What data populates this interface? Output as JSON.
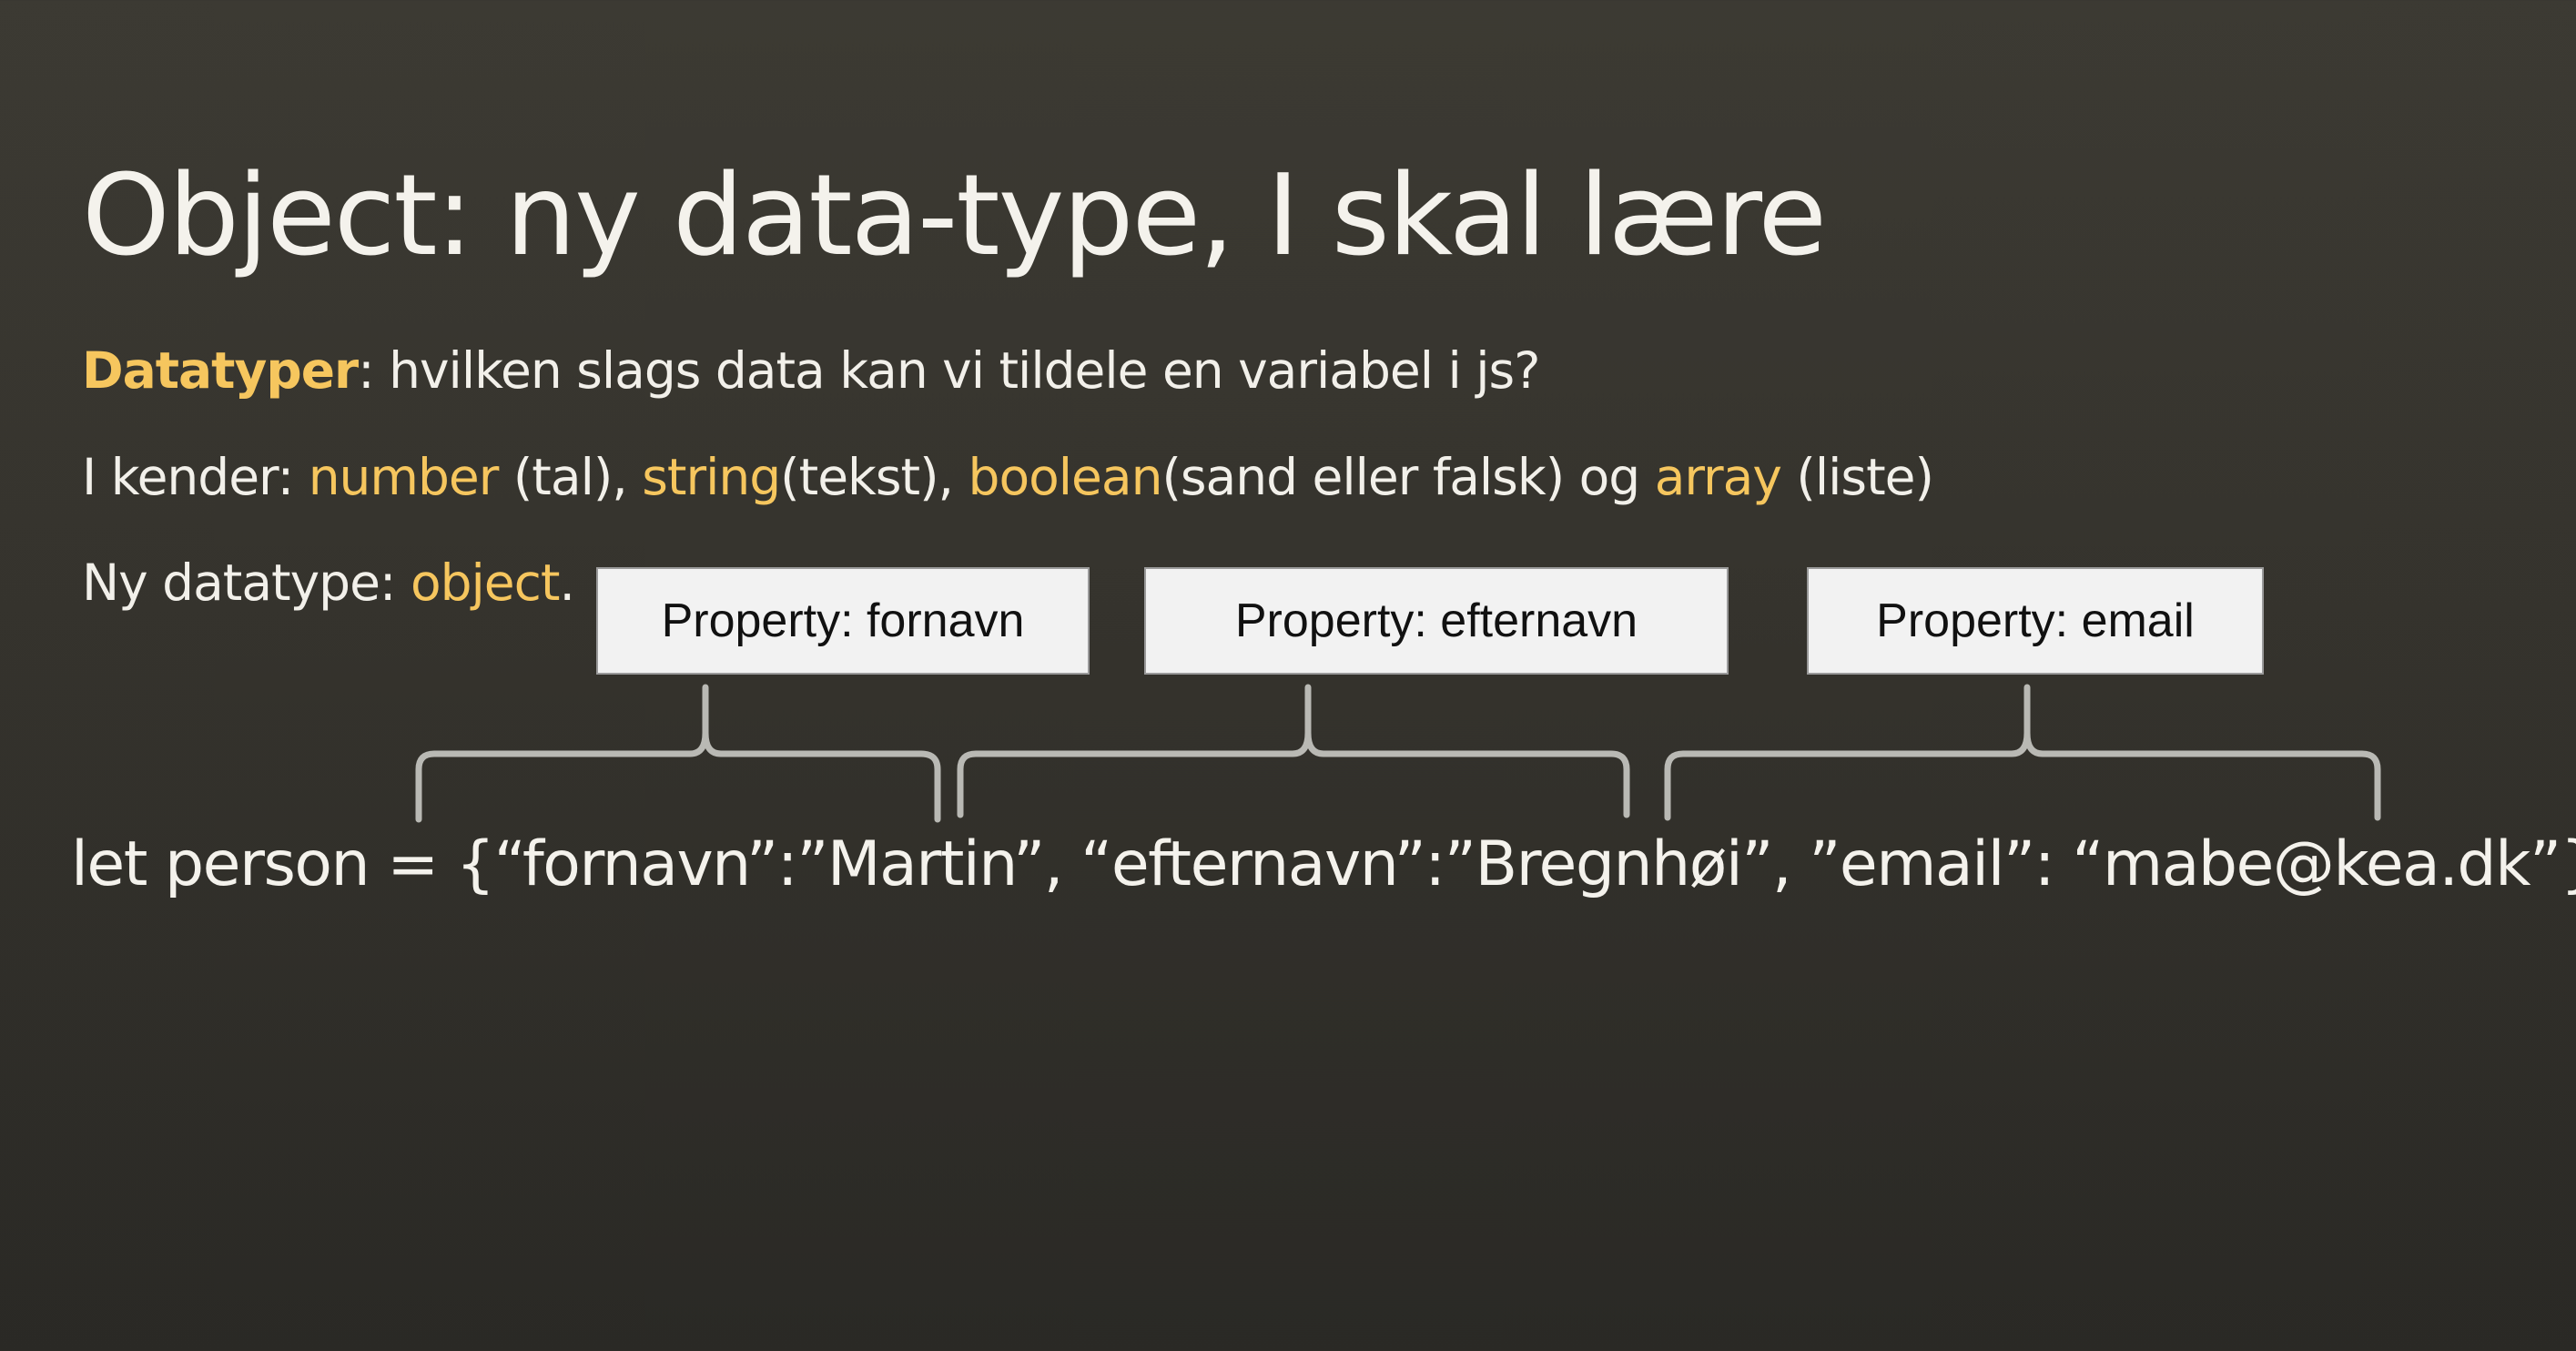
{
  "slide": {
    "title": "Object: ny data-type, I skal lære",
    "line1": {
      "keyword": "Datatyper",
      "rest": ": hvilken slags data kan vi tildele en variabel i js?"
    },
    "line2": {
      "prefix": "I kender: ",
      "number": "number",
      "number_note": " (tal), ",
      "string": "string",
      "string_note": "(tekst), ",
      "boolean": "boolean",
      "boolean_note": "(sand eller falsk) og ",
      "array": "array",
      "array_note": " (liste)"
    },
    "line3": {
      "prefix": "Ny datatype: ",
      "object": "object",
      "suffix": "."
    },
    "properties": [
      {
        "label": "Property: fornavn"
      },
      {
        "label": "Property: efternavn"
      },
      {
        "label": "Property: email"
      }
    ],
    "code": "let person = {“fornavn”:”Martin”,  “efternavn”:”Bregnhøi”,  ”email”: “mabe@kea.dk”}",
    "colors": {
      "background": "#3a3832",
      "text": "#f2f0ea",
      "keyword": "#f6c65e",
      "brace": "#b9b9b4",
      "box": "#f2f2f2"
    }
  }
}
